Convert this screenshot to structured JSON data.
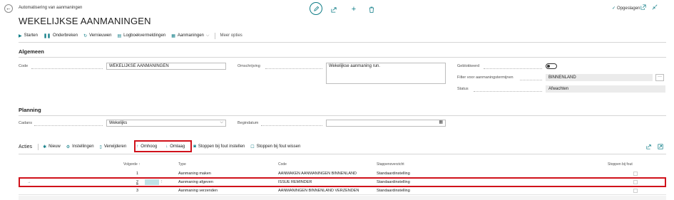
{
  "header": {
    "app_title": "Automatisering van aanmaningen",
    "page_title": "WEKELIJKSE AANMANINGEN",
    "saved_label": "Opgeslagen"
  },
  "icons": {
    "back": "back-arrow-icon",
    "edit": "pencil-icon",
    "share": "share-icon",
    "add": "plus-icon",
    "delete": "trash-icon",
    "open_new": "open-in-new-window-icon",
    "collapse": "collapse-icon"
  },
  "actions": {
    "start": "Starten",
    "pause": "Onderbreken",
    "refresh": "Vernieuwen",
    "log": "Logboekvermeldingen",
    "reminders": "Aanmaningen",
    "more": "Meer opties"
  },
  "general": {
    "title": "Algemeen",
    "code_label": "Code",
    "code_value": "WEKELIJKSE AANMANINGEN",
    "desc_label": "Omschrijving",
    "desc_value": "Wekelijkse aanmaning run.",
    "blocked_label": "Geblokkeerd",
    "filter_label": "Filter voor aanmaningstermijnen",
    "filter_value": "BINNENLAND",
    "status_label": "Status",
    "status_value": "Afwachten"
  },
  "planning": {
    "title": "Planning",
    "cadence_label": "Cadans",
    "cadence_value": "Wekelijks",
    "start_date_label": "Begindatum",
    "start_date_value": ""
  },
  "lines": {
    "title": "Acties",
    "new": "Nieuw",
    "settings": "Instellingen",
    "delete": "Verwijderen",
    "up": "Omhoog",
    "down": "Omlaag",
    "stop_on_error_set": "Stoppen bij fout instellen",
    "stop_on_error_clear": "Stoppen bij fout wissen",
    "columns": {
      "order": "Volgorde",
      "type": "Type",
      "code": "Code",
      "overview": "Stappenoverzicht",
      "stop": "Stoppen bij fout"
    },
    "rows": [
      {
        "order": "1",
        "type": "Aanmaning maken",
        "code": "AANMAKEN AANMANINGEN BINNENLAND",
        "overview": "Standaardinstelling"
      },
      {
        "order": "2",
        "type": "Aanmaning afgeven",
        "code": "ISSUE REMINDER",
        "overview": "Standaardinstelling"
      },
      {
        "order": "3",
        "type": "Aanmaning verzenden",
        "code": "AANMANINGEN BINNENLAND VERZENDEN",
        "overview": "Standaardinstelling"
      }
    ]
  },
  "colors": {
    "accent": "#0e7c86",
    "highlight_border": "#d0121b",
    "selection": "#bfe3e7"
  }
}
